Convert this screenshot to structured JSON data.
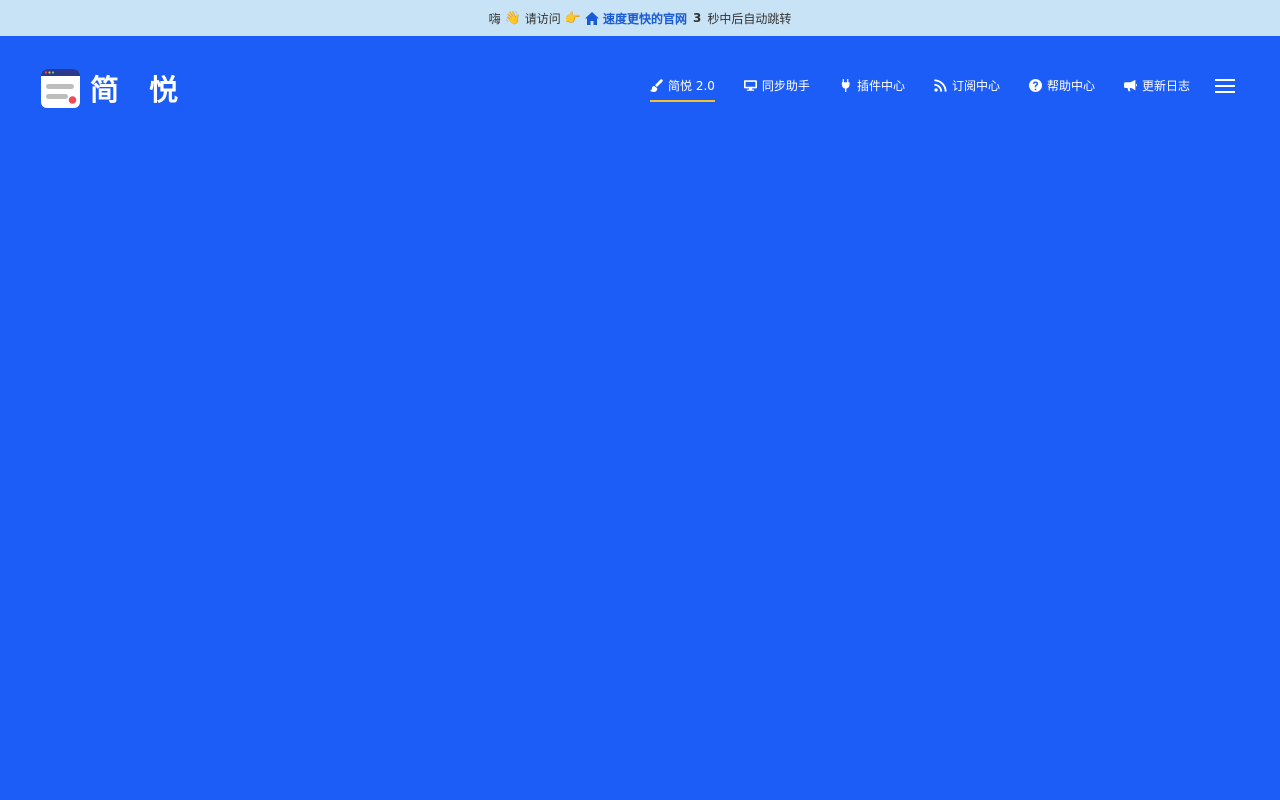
{
  "notice": {
    "greeting": "嗨",
    "wave_emoji": "👋",
    "prompt": "请访问",
    "point_emoji": "👉",
    "link_label": "速度更快的官网",
    "countdown": "3",
    "suffix": "秒中后自动跳转",
    "link_color": "#1a5ad6",
    "icon": "home-icon"
  },
  "header": {
    "logo_text": "简 悦",
    "logo_icon": "app-window-icon",
    "background": "#1c5cf7"
  },
  "nav": {
    "items": [
      {
        "label": "简悦 2.0",
        "icon": "brush-icon",
        "active": true
      },
      {
        "label": "同步助手",
        "icon": "monitor-icon",
        "active": false
      },
      {
        "label": "插件中心",
        "icon": "plug-icon",
        "active": false
      },
      {
        "label": "订阅中心",
        "icon": "rss-icon",
        "active": false
      },
      {
        "label": "帮助中心",
        "icon": "question-circle-icon",
        "active": false
      },
      {
        "label": "更新日志",
        "icon": "megaphone-icon",
        "active": false
      }
    ],
    "active_underline_color": "#f2c230",
    "menu_icon": "hamburger-menu-icon"
  }
}
